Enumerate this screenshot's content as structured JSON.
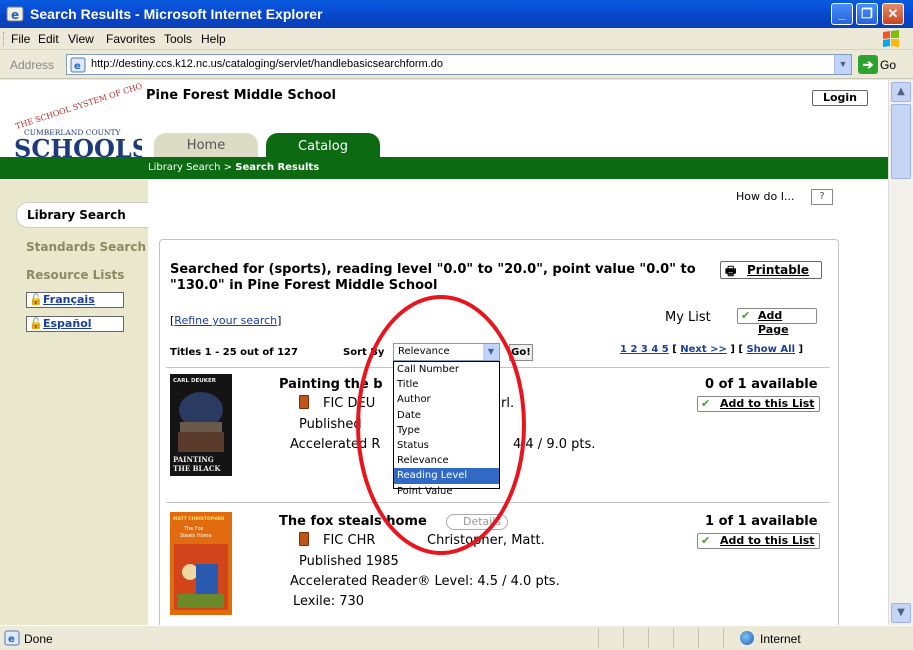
{
  "window": {
    "title": "Search Results - Microsoft Internet Explorer",
    "minimize": "_",
    "maximize": "❐",
    "close": "✕"
  },
  "menu": [
    "File",
    "Edit",
    "View",
    "Favorites",
    "Tools",
    "Help"
  ],
  "address": {
    "label": "Address",
    "url": "http://destiny.ccs.k12.nc.us/cataloging/servlet/handlebasicsearchform.do",
    "go_label": "Go"
  },
  "header": {
    "logo_top": "THE SCHOOL SYSTEM OF CHOICE",
    "logo_mid": "CUMBERLAND COUNTY",
    "logo_bottom": "SCHOOLS",
    "school_name": "Pine Forest Middle School",
    "login_label": "Login",
    "tabs": [
      {
        "label": "Home",
        "active": false
      },
      {
        "label": "Catalog",
        "active": true
      }
    ],
    "breadcrumb_prefix": "Library Search > ",
    "breadcrumb_current": "Search Results"
  },
  "sidebar": {
    "active": "Library Search",
    "links": [
      "Standards Search",
      "Resource Lists"
    ],
    "languages": [
      "Français",
      "Español"
    ]
  },
  "help": {
    "label": "How do I...",
    "button": "?"
  },
  "results": {
    "searched_for": "Searched for (sports), reading level \"0.0\" to \"20.0\", point value \"0.0\" to \"130.0\" in Pine Forest Middle School",
    "printable_label": "Printable",
    "refine_label": "Refine your search",
    "mylist_label": "My List",
    "addpage_label": "Add Page",
    "titles_count": "Titles 1 - 25 out of 127",
    "sort_label": "Sort By",
    "sort_selected": "Relevance",
    "go_label": "Go!",
    "pager_pages": "1 2 3 4 5",
    "pager_next": "Next >>",
    "pager_showall": "Show All",
    "sort_options": [
      "Call Number",
      "Title",
      "Author",
      "Date",
      "Type",
      "Status",
      "Relevance",
      "Reading Level",
      "Point Value"
    ],
    "sort_highlighted": "Reading Level",
    "items": [
      {
        "title": "Painting the b",
        "call": "FIC DEU",
        "author_fragment": "rl.",
        "published_fragment": "Published",
        "ar_fragment": "Accelerated R",
        "ar_level_fragment": "4.4 / 9.0 pts.",
        "availability": "0 of 1 available",
        "add_label": "Add to this List",
        "cover_top": "CARL DEUKER",
        "cover_bottom": "PAINTING THE BLACK"
      },
      {
        "title": "The fox steals home",
        "details_label": "Details",
        "call": "FIC CHR",
        "author": "Christopher, Matt.",
        "published": "Published 1985",
        "ar": "Accelerated Reader® Level:  4.5 / 4.0 pts.",
        "lexile": "Lexile: 730",
        "availability": "1 of 1 available",
        "add_label": "Add to this List",
        "cover_top": "MATT CHRISTOPHER",
        "cover_title": "The Fox Steals Home"
      }
    ]
  },
  "status": {
    "done": "Done",
    "zone": "Internet"
  }
}
